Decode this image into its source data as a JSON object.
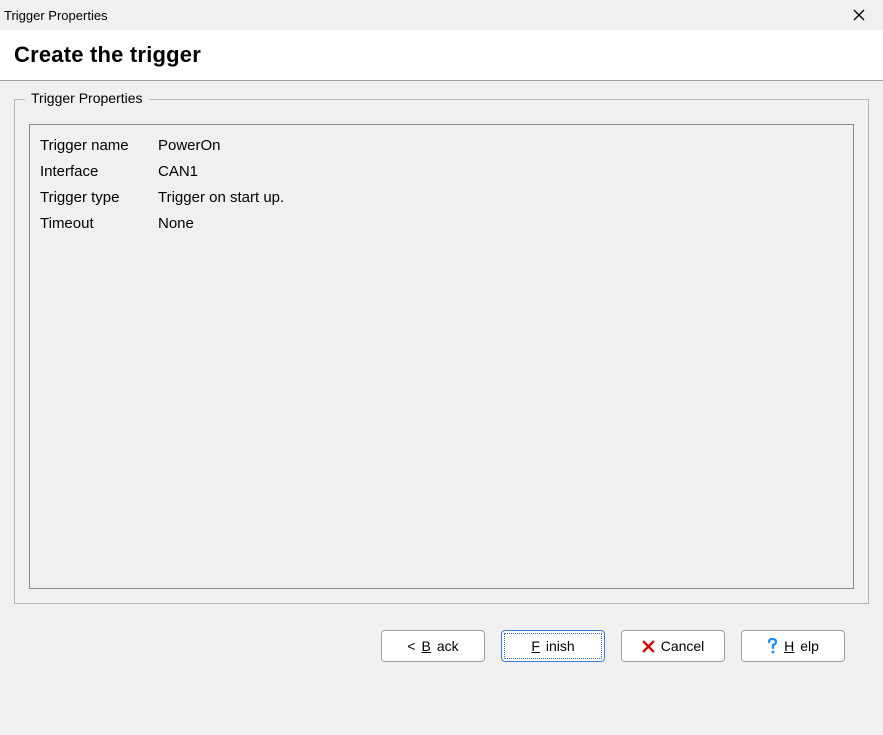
{
  "window": {
    "title": "Trigger Properties"
  },
  "header": {
    "title": "Create the trigger"
  },
  "groupbox": {
    "legend": "Trigger Properties"
  },
  "properties": {
    "rows": [
      {
        "label": "Trigger name",
        "value": "PowerOn"
      },
      {
        "label": "Interface",
        "value": "CAN1"
      },
      {
        "label": "Trigger type",
        "value": "Trigger on start up."
      },
      {
        "label": "Timeout",
        "value": "None"
      }
    ]
  },
  "buttons": {
    "back": {
      "prefix": "< ",
      "hotkey": "B",
      "rest": "ack"
    },
    "finish": {
      "hotkey": "F",
      "rest": "inish"
    },
    "cancel": {
      "label": "Cancel"
    },
    "help": {
      "hotkey": "H",
      "rest": "elp"
    }
  },
  "colors": {
    "cancel_icon": "#d40000",
    "help_icon": "#1a8cff"
  }
}
